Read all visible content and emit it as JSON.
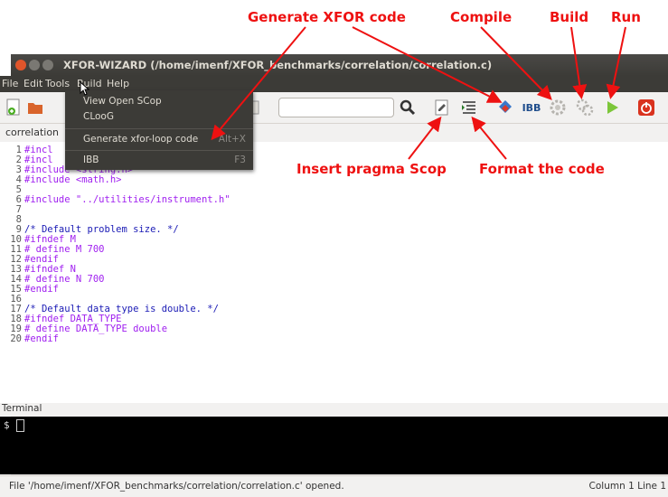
{
  "annotations": {
    "generate": "Generate XFOR code",
    "compile": "Compile",
    "build": "Build",
    "run": "Run",
    "insert_pragma": "Insert pragma Scop",
    "format": "Format the code"
  },
  "window": {
    "title": "XFOR-WIZARD (/home/imenf/XFOR_benchmarks/correlation/correlation.c)"
  },
  "menubar": {
    "items": [
      "File",
      "Edit",
      "Tools",
      "Build",
      "Help"
    ]
  },
  "tools_menu": {
    "items": [
      {
        "label": "View Open SCop",
        "accel": ""
      },
      {
        "label": "CLooG",
        "accel": ""
      },
      {
        "label": "Generate xfor-loop code",
        "accel": "Alt+X"
      },
      {
        "label": "IBB",
        "accel": "F3"
      }
    ]
  },
  "toolbar": {
    "search_value": "",
    "ibb_label": "IBB",
    "icons": [
      "new-file-icon",
      "open-folder-icon",
      "paste-icon",
      "search-icon",
      "insert-pragma-icon",
      "format-code-icon",
      "generate-xfor-icon",
      "ibb-icon",
      "compile-icon",
      "build-icon",
      "run-icon",
      "stop-icon"
    ]
  },
  "tab": {
    "label": "correlation"
  },
  "editor": {
    "lines": [
      {
        "n": "1",
        "text": "#incl"
      },
      {
        "n": "2",
        "text": "#incl"
      },
      {
        "n": "3",
        "text": "#include <string.h>"
      },
      {
        "n": "4",
        "text": "#include <math.h>"
      },
      {
        "n": "5",
        "text": ""
      },
      {
        "n": "6",
        "text": "#include \"../utilities/instrument.h\""
      },
      {
        "n": "7",
        "text": ""
      },
      {
        "n": "8",
        "text": ""
      },
      {
        "n": "9",
        "text": "/* Default problem size. */"
      },
      {
        "n": "10",
        "text": "#ifndef M"
      },
      {
        "n": "11",
        "text": "# define M 700"
      },
      {
        "n": "12",
        "text": "#endif"
      },
      {
        "n": "13",
        "text": "#ifndef N"
      },
      {
        "n": "14",
        "text": "# define N 700"
      },
      {
        "n": "15",
        "text": "#endif"
      },
      {
        "n": "16",
        "text": ""
      },
      {
        "n": "17",
        "text": "/* Default data type is double. */"
      },
      {
        "n": "18",
        "text": "#ifndef DATA_TYPE"
      },
      {
        "n": "19",
        "text": "# define DATA_TYPE double"
      },
      {
        "n": "20",
        "text": "#endif"
      }
    ]
  },
  "terminal": {
    "label": "Terminal",
    "prompt": "$"
  },
  "statusbar": {
    "message": "File '/home/imenf/XFOR_benchmarks/correlation/correlation.c' opened.",
    "position": "Column 1 Line 1"
  },
  "colors": {
    "annotation": "#ee1111",
    "titlebar": "#3c3b37",
    "preprocessor": "#a020f0",
    "comment": "#1a1ab5"
  }
}
